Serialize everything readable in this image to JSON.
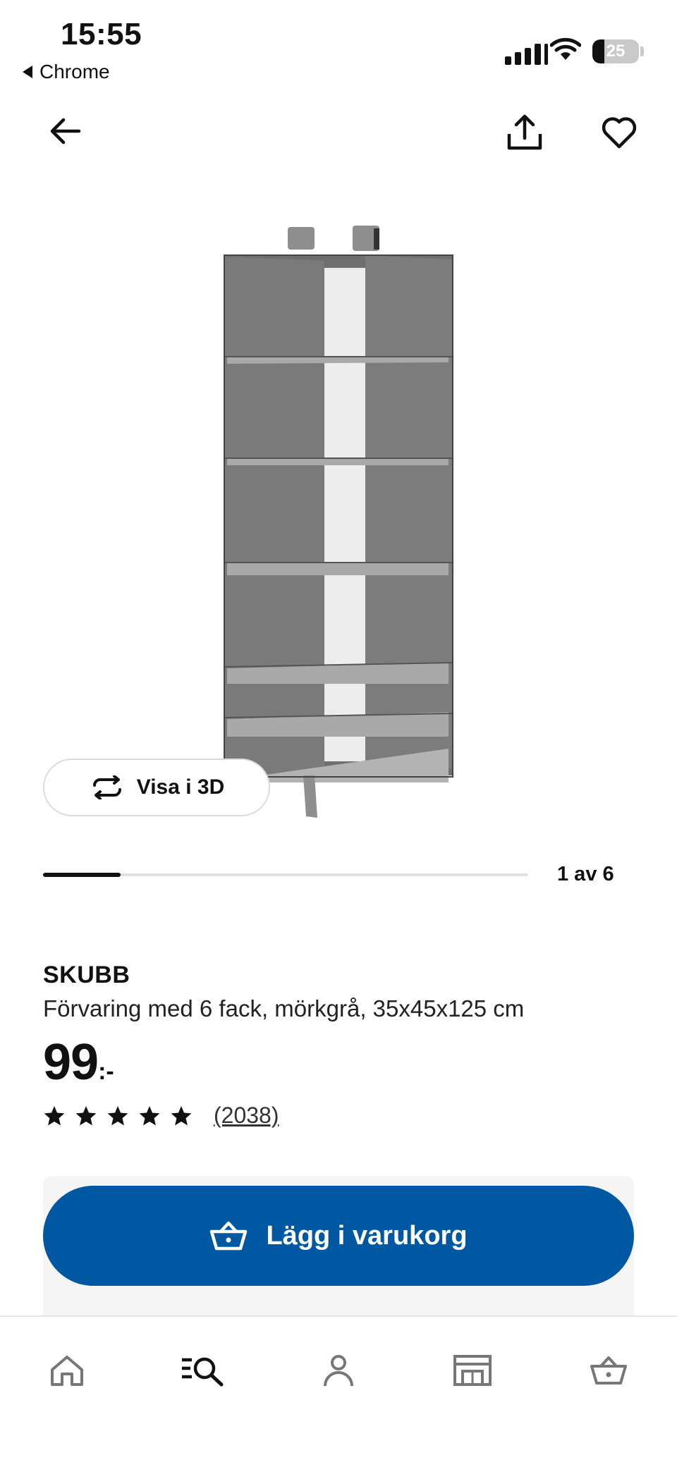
{
  "status_bar": {
    "time": "15:55",
    "back_app": "Chrome",
    "battery_level": 25,
    "battery_text": "25"
  },
  "header": {
    "back_icon": "arrow-left-icon",
    "share_icon": "share-icon",
    "favorite_icon": "heart-icon"
  },
  "gallery": {
    "view3d_label": "Visa i 3D",
    "position_text": "1 av 6",
    "progress": 0.16
  },
  "product": {
    "brand": "SKUBB",
    "description": "Förvaring med 6 fack, mörkgrå, 35x45x125 cm",
    "price_main": "99",
    "price_suffix": ":-",
    "rating_stars": 5,
    "review_count": "(2038)"
  },
  "cart": {
    "button_label": "Lägg i varukorg",
    "accent_color": "#0058a3"
  },
  "tabbar": {
    "items": [
      {
        "icon": "home-icon"
      },
      {
        "icon": "search-list-icon",
        "active": true
      },
      {
        "icon": "profile-icon"
      },
      {
        "icon": "store-icon"
      },
      {
        "icon": "cart-icon"
      }
    ]
  }
}
